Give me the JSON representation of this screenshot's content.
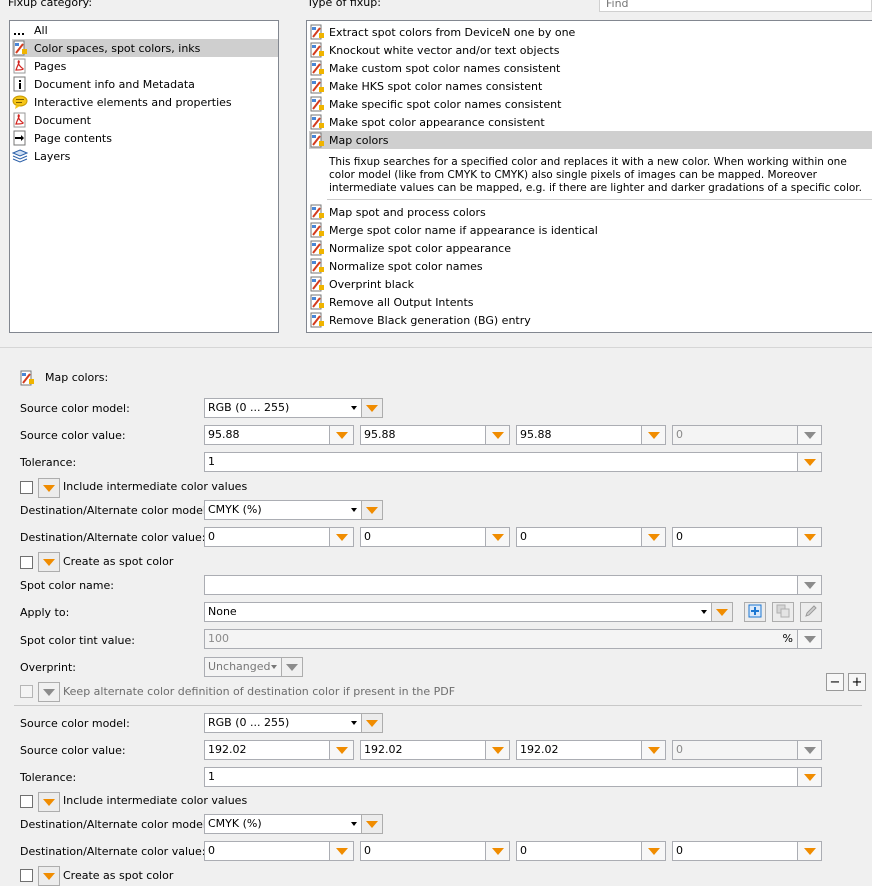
{
  "header": {
    "category_label": "Fixup category:",
    "type_label": "Type of fixup:",
    "find_placeholder": "Find"
  },
  "categories": [
    {
      "label": "All",
      "icon": "ellipsis-icon",
      "selected": false
    },
    {
      "label": "Color spaces, spot colors, inks",
      "icon": "color-fixup-icon",
      "selected": true
    },
    {
      "label": "Pages",
      "icon": "pdf-icon",
      "selected": false
    },
    {
      "label": "Document info and Metadata",
      "icon": "info-icon",
      "selected": false
    },
    {
      "label": "Interactive elements and properties",
      "icon": "speech-bubble-icon",
      "selected": false
    },
    {
      "label": "Document",
      "icon": "pdf-icon",
      "selected": false
    },
    {
      "label": "Page contents",
      "icon": "page-contents-icon",
      "selected": false
    },
    {
      "label": "Layers",
      "icon": "layers-icon",
      "selected": false
    }
  ],
  "fixups_before": [
    "Extract spot colors from DeviceN one by one",
    "Knockout white vector and/or text objects",
    "Make custom spot color names consistent",
    "Make HKS spot color names consistent",
    "Make specific spot color names consistent",
    "Make spot color appearance consistent"
  ],
  "fixup_selected": "Map colors",
  "fixup_description": "This fixup searches for a specified color and replaces it with a new color. When working within one color model (like from CMYK to CMYK) also single pixels of images can be mapped. Moreover intermediate values can be mapped, e.g. if there are lighter and darker gradations of a specific color.",
  "fixups_after": [
    "Map spot and process colors",
    "Merge spot color name if appearance is identical",
    "Normalize spot color appearance",
    "Normalize spot color names",
    "Overprint black",
    "Remove all Output Intents",
    "Remove Black generation (BG) entry"
  ],
  "panel": {
    "title": "Map colors:",
    "labels": {
      "source_model": "Source color model:",
      "source_value": "Source color value:",
      "tolerance": "Tolerance:",
      "include_intermediate": "Include intermediate color values",
      "dest_model": "Destination/Alternate color model:",
      "dest_value": "Destination/Alternate color value:",
      "create_spot": "Create as spot color",
      "spot_name": "Spot color name:",
      "apply_to": "Apply to:",
      "tint": "Spot color tint value:",
      "overprint": "Overprint:",
      "keep_alternate": "Keep alternate color definition of destination color if present in the PDF"
    },
    "mapping1": {
      "source_model": "RGB (0 ... 255)",
      "source_values": [
        "95.88",
        "95.88",
        "95.88",
        "0"
      ],
      "tolerance": "1",
      "dest_model": "CMYK (%)",
      "dest_values": [
        "0",
        "0",
        "0",
        "0"
      ],
      "spot_name": "",
      "apply_to": "None",
      "tint": "100",
      "tint_unit": "%",
      "overprint": "Unchanged"
    },
    "mapping2": {
      "source_model": "RGB (0 ... 255)",
      "source_values": [
        "192.02",
        "192.02",
        "192.02",
        "0"
      ],
      "tolerance": "1",
      "dest_model": "CMYK (%)",
      "dest_values": [
        "0",
        "0",
        "0",
        "0"
      ]
    },
    "remove_label": "−",
    "add_label": "+"
  },
  "colors": {
    "accent": "#f08c00",
    "selection": "#cfcfcf",
    "plus_blue": "#1e78d2"
  }
}
